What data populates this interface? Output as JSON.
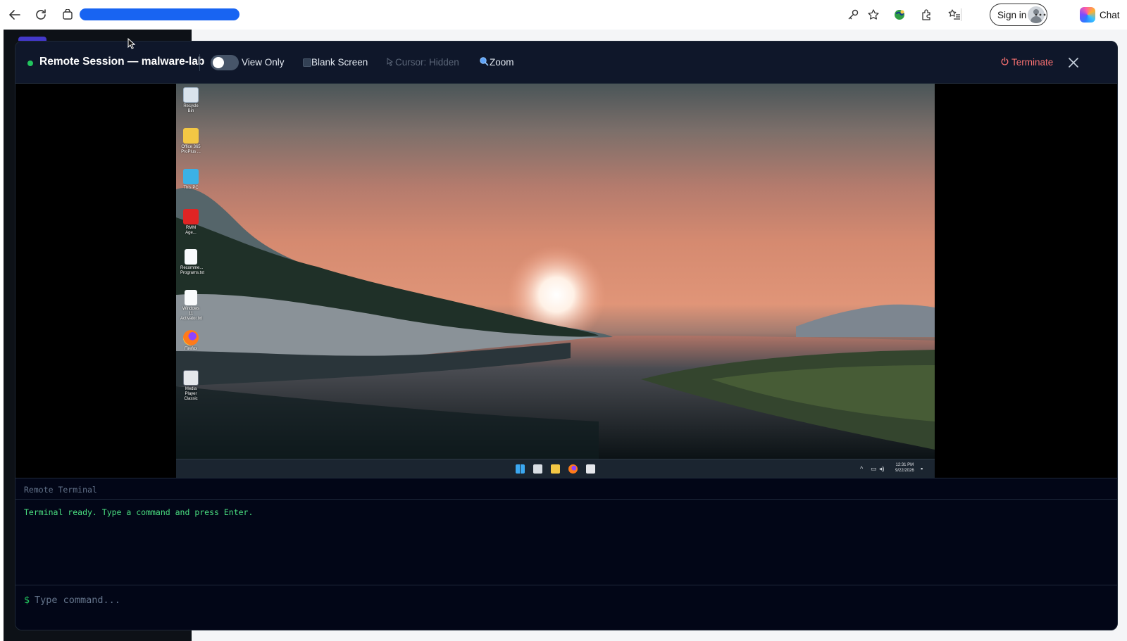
{
  "browser": {
    "signin_label": "Sign in",
    "chat_label": "Chat",
    "icons": [
      "back-icon",
      "refresh-icon",
      "site-info-icon",
      "key-icon",
      "favorite-star-icon",
      "vpn-globe-icon",
      "extensions-icon",
      "favorites-list-icon",
      "more-icon",
      "copilot-icon"
    ]
  },
  "session": {
    "title": "Remote Session — malware-lab",
    "status_color": "#22c55e",
    "view_only_label": "View Only",
    "view_only_on": false,
    "blank_screen_label": "Blank Screen",
    "blank_screen_checked": false,
    "cursor_label": "Cursor: Hidden",
    "zoom_label": "Zoom",
    "terminate_label": "Terminate",
    "terminate_color": "#f87171"
  },
  "desktop": {
    "icons": [
      {
        "label": "Recycle Bin",
        "icon": "recycle-bin-icon"
      },
      {
        "label": "Office 365 ProPlus ...",
        "icon": "folder-icon"
      },
      {
        "label": "This PC",
        "icon": "monitor-icon"
      },
      {
        "label": "RMM Age...",
        "icon": "pdf-icon"
      },
      {
        "label": "Recomme... Programs.txt",
        "icon": "text-file-icon"
      },
      {
        "label": "Windows 11 Activator.txt",
        "icon": "text-file-icon"
      },
      {
        "label": "Firefox",
        "icon": "firefox-icon"
      },
      {
        "label": "Media Player Classic",
        "icon": "media-player-icon"
      }
    ],
    "taskbar_apps": [
      "windows-start-icon",
      "task-view-icon",
      "file-explorer-icon",
      "firefox-icon",
      "media-player-icon"
    ],
    "clock_time": "12:31 PM",
    "clock_date": "9/22/2026"
  },
  "terminal": {
    "title": "Remote Terminal",
    "output": "Terminal ready. Type a command and press Enter.",
    "prompt": "$",
    "input_placeholder": "Type command..."
  }
}
